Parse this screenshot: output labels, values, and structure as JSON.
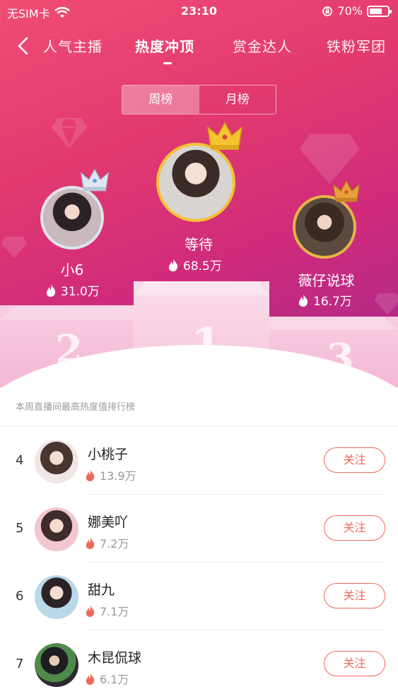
{
  "status_bar": {
    "carrier": "无SIM卡",
    "time": "23:10",
    "battery": "70%",
    "battery_level": 0.7
  },
  "nav": {
    "tabs": [
      {
        "label": "人气主播",
        "active": false
      },
      {
        "label": "热度冲顶",
        "active": true
      },
      {
        "label": "赏金达人",
        "active": false
      },
      {
        "label": "铁粉军团",
        "active": false
      }
    ]
  },
  "segment": {
    "options": [
      "周榜",
      "月榜"
    ],
    "selected": "周榜"
  },
  "podium": [
    {
      "rank": "1",
      "name": "等待",
      "heat": "68.5万",
      "crown_color": "#f5c531"
    },
    {
      "rank": "2",
      "name": "小6",
      "heat": "31.0万",
      "crown_color": "#dfe6ef"
    },
    {
      "rank": "3",
      "name": "薇仔说球",
      "heat": "16.7万",
      "crown_color": "#e8a13a"
    }
  ],
  "caption": "本周直播间最高热度值排行榜",
  "follow_label": "关注",
  "list": [
    {
      "rank": "4",
      "name": "小桃子",
      "heat": "13.9万"
    },
    {
      "rank": "5",
      "name": "娜美吖",
      "heat": "7.2万"
    },
    {
      "rank": "6",
      "name": "甜九",
      "heat": "7.1万"
    },
    {
      "rank": "7",
      "name": "木昆侃球",
      "heat": "6.1万"
    }
  ],
  "colors": {
    "accent": "#ee6a5b",
    "gradient_top": "#ef4d73",
    "gradient_bottom": "#a52a8c"
  }
}
